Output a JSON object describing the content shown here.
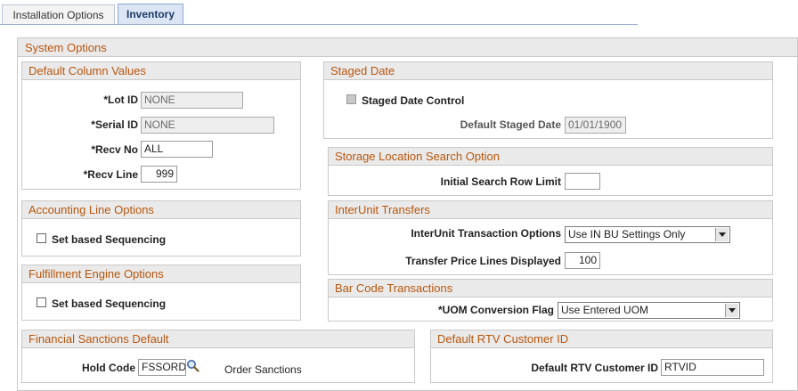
{
  "tabs": [
    {
      "label": "Installation Options",
      "active": false
    },
    {
      "label": "Inventory",
      "active": true
    }
  ],
  "system_options": {
    "title": "System Options"
  },
  "default_column_values": {
    "title": "Default Column Values",
    "lot_id_label": "*Lot ID",
    "lot_id_value": "NONE",
    "serial_id_label": "*Serial ID",
    "serial_id_value": "NONE",
    "recv_no_label": "*Recv No",
    "recv_no_value": "ALL",
    "recv_line_label": "*Recv Line",
    "recv_line_value": "999"
  },
  "staged_date": {
    "title": "Staged Date",
    "control_label": "Staged Date Control",
    "control_checked": false,
    "default_label": "Default Staged Date",
    "default_value": "01/01/1900"
  },
  "storage_location": {
    "title": "Storage Location Search Option",
    "row_limit_label": "Initial Search Row Limit",
    "row_limit_value": ""
  },
  "accounting_line": {
    "title": "Accounting Line Options",
    "set_based_label": "Set based Sequencing",
    "checked": false
  },
  "interunit": {
    "title": "InterUnit Transfers",
    "options_label": "InterUnit Transaction Options",
    "options_value": "Use IN BU Settings Only",
    "price_lines_label": "Transfer Price Lines Displayed",
    "price_lines_value": "100"
  },
  "fulfillment": {
    "title": "Fulfillment Engine Options",
    "set_based_label": "Set based Sequencing",
    "checked": false
  },
  "barcode": {
    "title": "Bar Code Transactions",
    "uom_label": "*UOM Conversion Flag",
    "uom_value": "Use Entered UOM"
  },
  "financial_sanctions": {
    "title": "Financial Sanctions Default",
    "hold_code_label": "Hold Code",
    "hold_code_value": "FSSORD",
    "hold_code_desc": "Order Sanctions",
    "lookup_icon": "magnifier-icon"
  },
  "rtv": {
    "title": "Default RTV Customer ID",
    "customer_label": "Default RTV Customer ID",
    "customer_value": "RTVID"
  },
  "colors": {
    "header_text": "#b8560d",
    "header_bg": "#eaeaea",
    "tab_active_bg": "#dbe5f3"
  }
}
